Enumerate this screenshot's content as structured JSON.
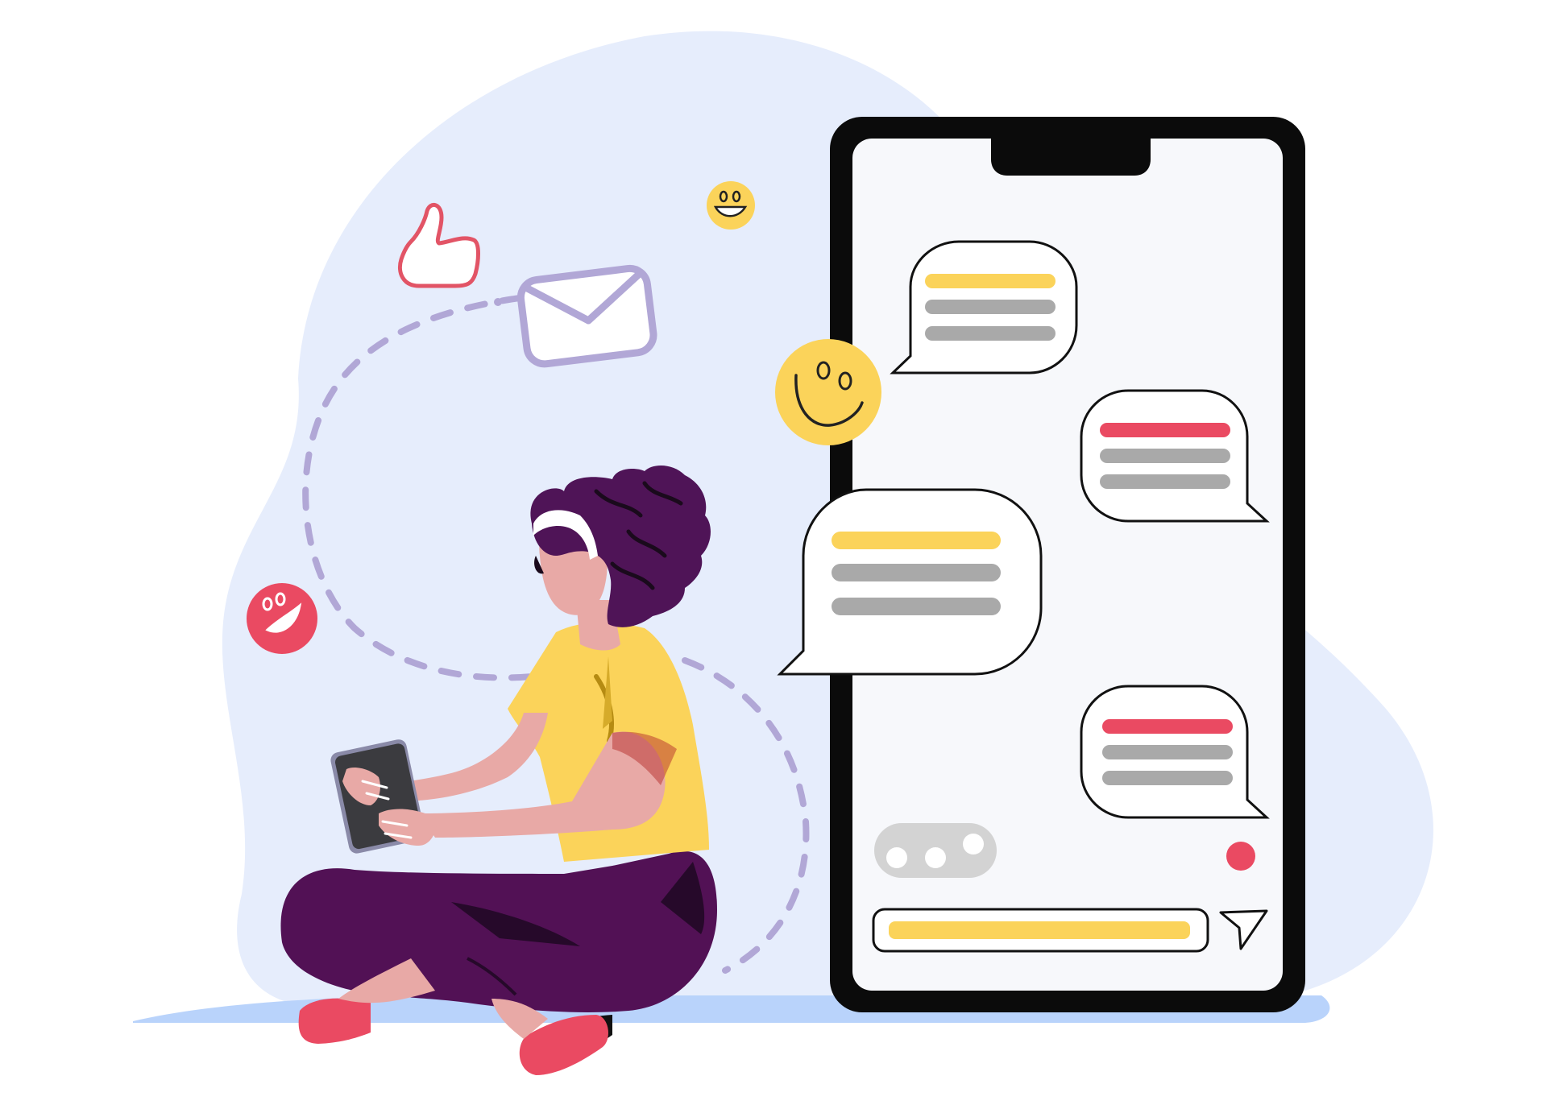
{
  "illustration": {
    "colors": {
      "background": "#ffffff",
      "blob": "#e6edfc",
      "floor": "#b9d3fb",
      "phone_frame": "#0b0b0b",
      "phone_screen": "#f7f8fb",
      "accent_yellow": "#fbd35a",
      "accent_red": "#ea4a62",
      "text_gray": "#a9a9a9",
      "dash_purple": "#b1a7d6",
      "hair_purple": "#4f1457",
      "pants_purple": "#521155",
      "skin": "#e8a9a6",
      "shirt": "#fbd35a",
      "shoe": "#ea4a62",
      "tablet": "#3b3b3f",
      "typing_bubble": "#d3d3d3"
    },
    "icons": [
      "thumbs-up-icon",
      "envelope-icon",
      "small-smiley-icon",
      "large-smiley-icon",
      "laughing-emoji-icon",
      "send-icon",
      "typing-dots-icon"
    ],
    "phone": {
      "chat_messages": [
        {
          "side": "left",
          "accent": "yellow"
        },
        {
          "side": "right",
          "accent": "red"
        },
        {
          "side": "left",
          "accent": "yellow"
        },
        {
          "side": "right",
          "accent": "red"
        }
      ]
    }
  }
}
